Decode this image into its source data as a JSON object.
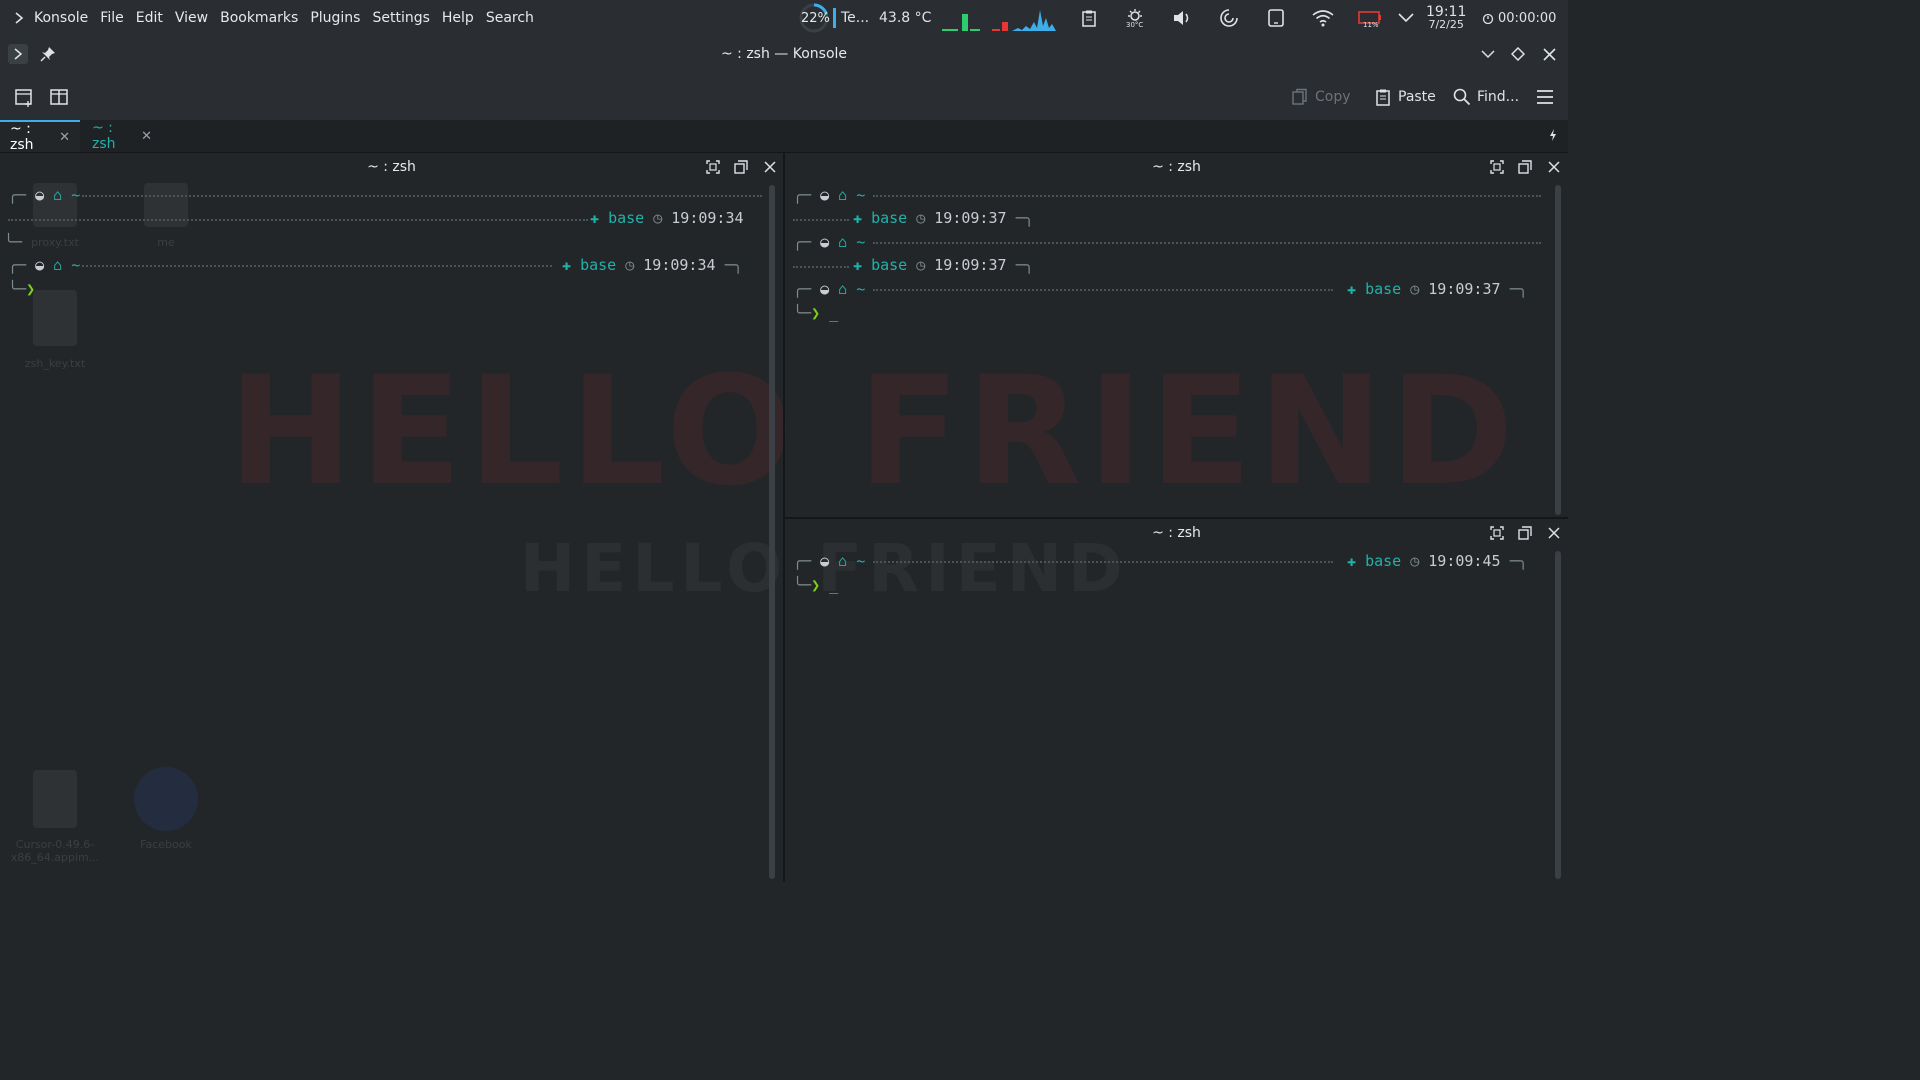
{
  "panel": {
    "app_name": "Konsole",
    "menu": [
      "File",
      "Edit",
      "View",
      "Bookmarks",
      "Plugins",
      "Settings",
      "Help",
      "Search"
    ],
    "battery_percent": "22%",
    "temp_label": "Te...",
    "temp_value": "43.8 °C",
    "weather_temp": "30°C",
    "battery_indicator": "11%",
    "clock_time": "19:11",
    "clock_date": "7/2/25",
    "timer": "00:00:00",
    "icons": [
      "clipboard-icon",
      "weather-icon",
      "volume-icon",
      "vpn-icon",
      "tablet-icon",
      "wifi-icon",
      "battery-icon",
      "chevron-down-icon",
      "timer-icon"
    ],
    "accent_colors": {
      "cpu_bar": "#2ecc71",
      "mem_bar": "#e53935",
      "net_graph": "#3daee9"
    }
  },
  "window": {
    "title": "~ : zsh — Konsole"
  },
  "toolbar": {
    "copy_label": "Copy",
    "paste_label": "Paste",
    "find_label": "Find..."
  },
  "tabs": [
    {
      "label": "~ : zsh"
    },
    {
      "label": "~ : zsh"
    }
  ],
  "panes": [
    {
      "title": "~ : zsh",
      "prompts": [
        {
          "env": "base",
          "time": "19:09:34"
        },
        {
          "env": "base",
          "time": "19:09:34"
        }
      ]
    },
    {
      "title": "~ : zsh",
      "prompts": [
        {
          "env": "base",
          "time": "19:09:37"
        },
        {
          "env": "base",
          "time": "19:09:37"
        },
        {
          "env": "base",
          "time": "19:09:37"
        }
      ]
    },
    {
      "title": "~ : zsh",
      "prompts": [
        {
          "env": "base",
          "time": "19:09:45"
        }
      ]
    }
  ],
  "prompt_symbols": {
    "home": "~",
    "caret": "❯",
    "cursor": "_"
  },
  "wallpaper": {
    "text": "HELLO FRIEND",
    "sub_text": "HELLO FRIEND",
    "desktop_icons": [
      "proxy.txt",
      "me",
      "zsh_key.txt",
      "Cursor-0.49.6-x86_64.appim...",
      "Facebook"
    ]
  }
}
